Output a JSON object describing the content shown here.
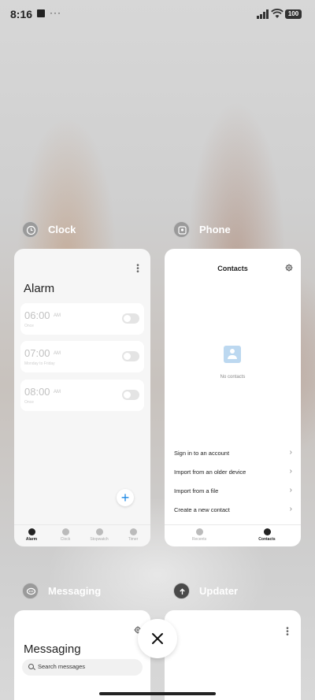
{
  "status_bar": {
    "time": "8:16",
    "more_dots": "···",
    "battery": "100"
  },
  "apps": {
    "clock": {
      "name": "Clock",
      "screen_title": "Alarm",
      "alarms": [
        {
          "time": "06:00",
          "ampm": "AM",
          "sub": "Once",
          "enabled": false
        },
        {
          "time": "07:00",
          "ampm": "AM",
          "sub": "Monday to Friday",
          "enabled": false
        },
        {
          "time": "08:00",
          "ampm": "AM",
          "sub": "Once",
          "enabled": false
        }
      ],
      "fab_symbol": "+",
      "nav": [
        {
          "label": "Alarm",
          "active": true
        },
        {
          "label": "Clock",
          "active": false
        },
        {
          "label": "Stopwatch",
          "active": false
        },
        {
          "label": "Timer",
          "active": false
        }
      ]
    },
    "phone": {
      "name": "Phone",
      "screen_title": "Contacts",
      "empty_text": "No contacts",
      "actions": [
        {
          "label": "Sign in to an account"
        },
        {
          "label": "Import from an older device"
        },
        {
          "label": "Import from a file"
        },
        {
          "label": "Create a new contact"
        }
      ],
      "nav": [
        {
          "label": "Recents",
          "active": false
        },
        {
          "label": "Contacts",
          "active": true
        }
      ]
    },
    "messaging": {
      "name": "Messaging",
      "screen_title": "Messaging",
      "search_placeholder": "Search messages"
    },
    "updater": {
      "name": "Updater"
    }
  },
  "close_button_symbol": "✕",
  "colors": {
    "accent": "#1e88e5",
    "background": "#c9c9c9"
  }
}
